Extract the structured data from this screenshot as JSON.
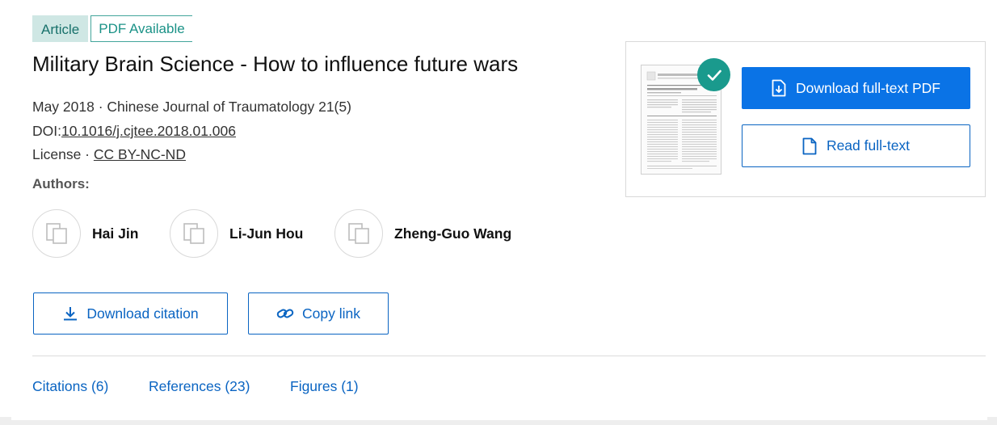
{
  "badges": {
    "type": "Article",
    "availability": "PDF Available"
  },
  "title": "Military Brain Science - How to influence future wars",
  "meta": {
    "date": "May 2018",
    "separator": " · ",
    "journal": "Chinese Journal of Traumatology 21(5)",
    "doi_label": "DOI:",
    "doi": "10.1016/j.cjtee.2018.01.006",
    "license_label": "License · ",
    "license": "CC BY-NC-ND"
  },
  "authors_label": "Authors:",
  "authors": [
    {
      "name": "Hai Jin"
    },
    {
      "name": "Li-Jun Hou"
    },
    {
      "name": "Zheng-Guo Wang"
    }
  ],
  "actions": {
    "download_citation": "Download citation",
    "copy_link": "Copy link"
  },
  "tabs": [
    {
      "label": "Citations (6)"
    },
    {
      "label": "References (23)"
    },
    {
      "label": "Figures (1)"
    }
  ],
  "side": {
    "download_pdf": "Download full-text PDF",
    "read_fulltext": "Read full-text"
  },
  "colors": {
    "primary": "#0a73e6",
    "link": "#0a64c2",
    "teal": "#1a9a8d",
    "badge_bg": "#cfe7e4"
  },
  "icons": {
    "avatar": "avatar-placeholder-icon",
    "download": "download-icon",
    "link": "link-icon",
    "pdf": "pdf-download-icon",
    "document": "document-icon",
    "check": "check-icon"
  }
}
